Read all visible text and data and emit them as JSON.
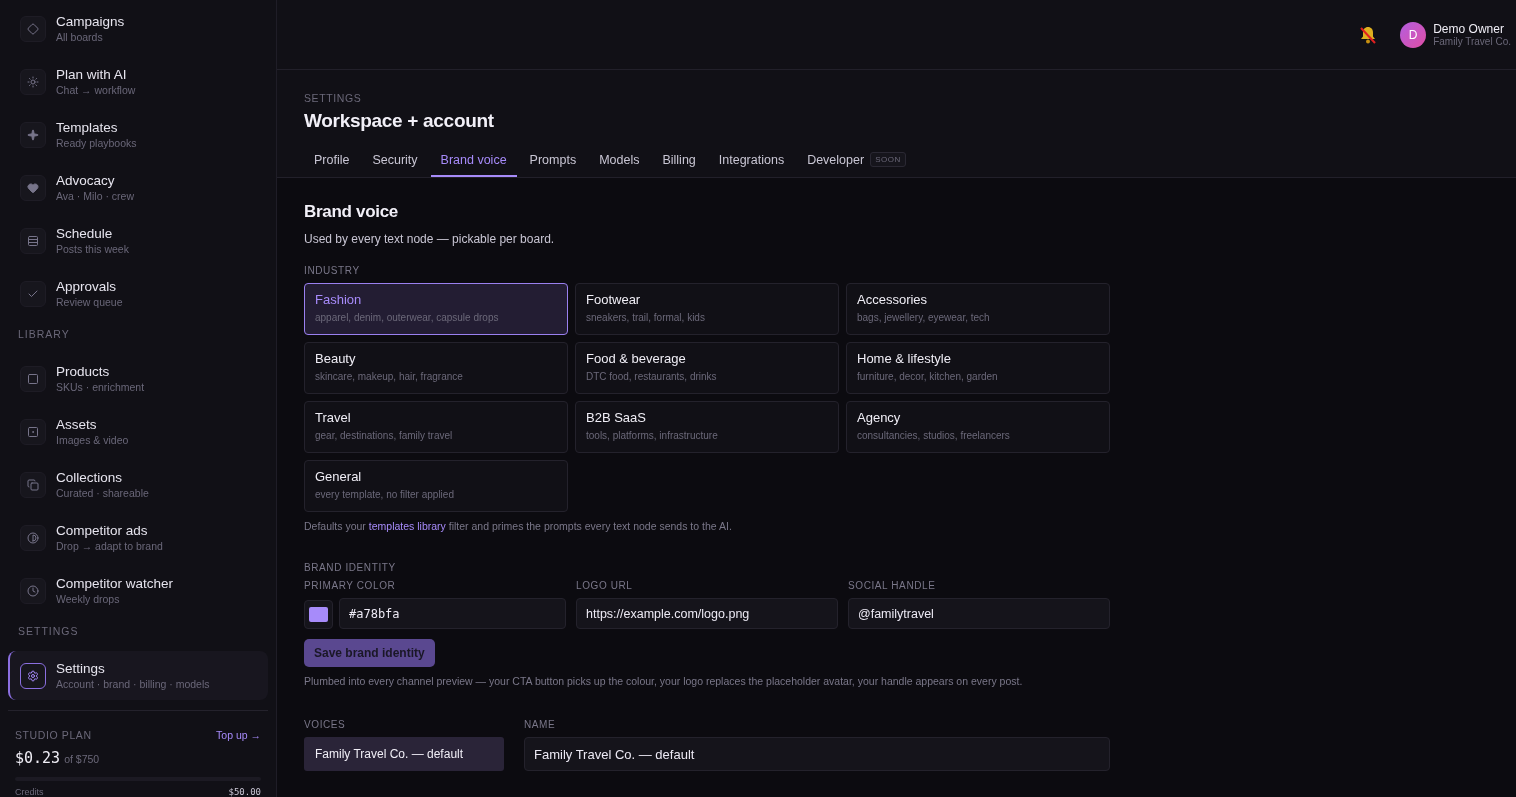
{
  "sidebar": {
    "sections": [
      {
        "items": [
          {
            "title": "Campaigns",
            "subtitle": "All boards",
            "selected": false
          },
          {
            "title": "Plan with AI",
            "subtitle": "Chat → workflow",
            "selected": false
          },
          {
            "title": "Templates",
            "subtitle": "Ready playbooks",
            "selected": false
          },
          {
            "title": "Advocacy",
            "subtitle": "Ava · Milo · crew",
            "selected": false
          },
          {
            "title": "Schedule",
            "subtitle": "Posts this week",
            "selected": false
          },
          {
            "title": "Approvals",
            "subtitle": "Review queue",
            "selected": false
          }
        ]
      },
      {
        "heading": "LIBRARY",
        "items": [
          {
            "title": "Products",
            "subtitle": "SKUs · enrichment",
            "selected": false
          },
          {
            "title": "Assets",
            "subtitle": "Images & video",
            "selected": false
          },
          {
            "title": "Collections",
            "subtitle": "Curated · shareable",
            "selected": false
          },
          {
            "title": "Competitor ads",
            "subtitle": "Drop → adapt to brand",
            "selected": false
          },
          {
            "title": "Competitor watcher",
            "subtitle": "Weekly drops",
            "selected": false
          }
        ]
      },
      {
        "heading": "SETTINGS",
        "items": [
          {
            "title": "Settings",
            "subtitle": "Account · brand · billing · models",
            "selected": true
          }
        ]
      }
    ],
    "plan": {
      "label": "STUDIO PLAN",
      "link": "Top up →",
      "amount": "$0.23",
      "of": "of $750",
      "level": 0.0003,
      "credits_label": "Credits",
      "credits_value": "$50.00"
    }
  },
  "header": {
    "user": {
      "initial": "D",
      "name": "Demo Owner",
      "org": "Family Travel Co."
    }
  },
  "page": {
    "eyebrow": "SETTINGS",
    "title": "Workspace + account"
  },
  "tabs": [
    {
      "label": "Profile",
      "selected": false
    },
    {
      "label": "Security",
      "selected": false
    },
    {
      "label": "Brand voice",
      "selected": true
    },
    {
      "label": "Prompts",
      "selected": false
    },
    {
      "label": "Models",
      "selected": false
    },
    {
      "label": "Billing",
      "selected": false
    },
    {
      "label": "Integrations",
      "selected": false
    },
    {
      "label": "Developer",
      "selected": false,
      "badge": "SOON"
    }
  ],
  "section": {
    "title": "Brand voice",
    "description": "Used by every text node — pickable per board."
  },
  "industry": {
    "label": "INDUSTRY",
    "options": [
      {
        "name": "Fashion",
        "detail": "apparel, denim, outerwear, capsule drops",
        "selected": true
      },
      {
        "name": "Footwear",
        "detail": "sneakers, trail, formal, kids",
        "selected": false
      },
      {
        "name": "Accessories",
        "detail": "bags, jewellery, eyewear, tech",
        "selected": false
      },
      {
        "name": "Beauty",
        "detail": "skincare, makeup, hair, fragrance",
        "selected": false
      },
      {
        "name": "Food & beverage",
        "detail": "DTC food, restaurants, drinks",
        "selected": false
      },
      {
        "name": "Home & lifestyle",
        "detail": "furniture, decor, kitchen, garden",
        "selected": false
      },
      {
        "name": "Travel",
        "detail": "gear, destinations, family travel",
        "selected": false
      },
      {
        "name": "B2B SaaS",
        "detail": "tools, platforms, infrastructure",
        "selected": false
      },
      {
        "name": "Agency",
        "detail": "consultancies, studios, freelancers",
        "selected": false
      },
      {
        "name": "General",
        "detail": "every template, no filter applied",
        "selected": false
      }
    ],
    "note_before": "Defaults your",
    "note_link": "templates library",
    "note_after": "filter and primes the prompts every text node sends to the AI."
  },
  "brand_identity": {
    "label": "BRAND IDENTITY",
    "primary_color": {
      "label": "PRIMARY COLOR",
      "value": "#a78bfa",
      "color": "#a78bfa"
    },
    "logo_url": {
      "label": "LOGO URL",
      "value": "https://example.com/logo.png"
    },
    "social_handle": {
      "label": "SOCIAL HANDLE",
      "value": "@familytravel"
    },
    "save": "Save brand identity",
    "note": "Plumbed into every channel preview — your CTA button picks up the colour, your logo replaces the placeholder avatar, your handle appears on every post."
  },
  "voices": {
    "label": "VOICES",
    "items": [
      {
        "name": "Family Travel Co. — default",
        "selected": true
      }
    ],
    "name_label": "NAME",
    "name_value": "Family Travel Co. — default"
  }
}
